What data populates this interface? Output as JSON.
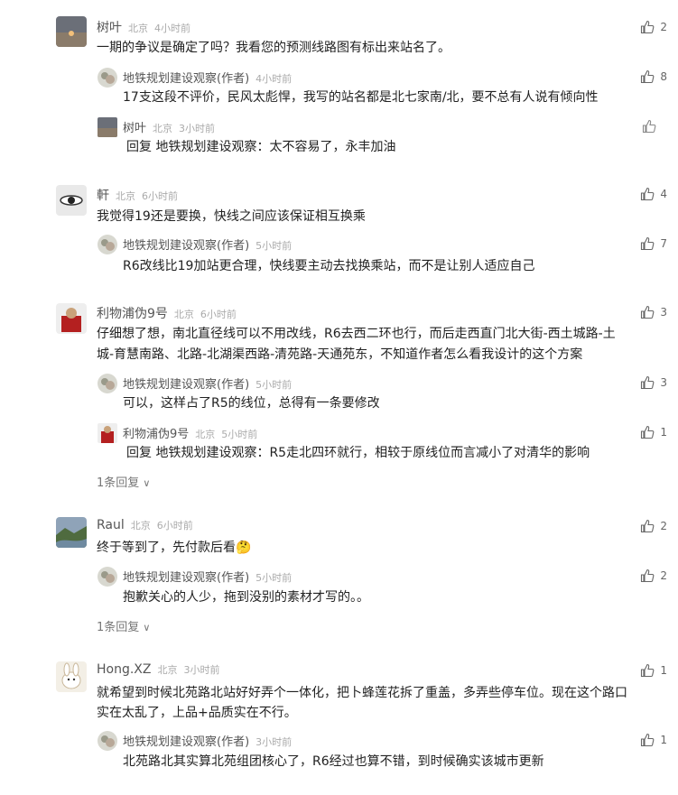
{
  "comments": [
    {
      "user": "树叶",
      "loc": "北京",
      "time": "4小时前",
      "likes": "2",
      "text": "一期的争议是确定了吗？我看您的预测线路图有标出来站名了。",
      "replies": [
        {
          "user": "地铁规划建设观察(作者)",
          "loc": "",
          "time": "4小时前",
          "likes": "8",
          "text": "17支这段不评价，民风太彪悍，我写的站名都是北七家南/北，要不总有人说有倾向性"
        },
        {
          "user": "树叶",
          "loc": "北京",
          "time": "3小时前",
          "likes": "",
          "reply_prefix": "回复",
          "reply_target": "地铁规划建设观察：",
          "text": "太不容易了，永丰加油"
        }
      ]
    },
    {
      "user": "軒",
      "loc": "北京",
      "time": "6小时前",
      "likes": "4",
      "text": "我觉得19还是要换，快线之间应该保证相互换乘",
      "replies": [
        {
          "user": "地铁规划建设观察(作者)",
          "loc": "",
          "time": "5小时前",
          "likes": "7",
          "text": "R6改线比19加站更合理，快线要主动去找换乘站，而不是让别人适应自己"
        }
      ]
    },
    {
      "user": "利物浦伪9号",
      "loc": "北京",
      "time": "6小时前",
      "likes": "3",
      "text_lines": [
        "仔细想了想，南北直径线可以不用改线，R6去西二环也行，而后走西直门北大街-西土城路-土",
        "城-育慧南路、北路-北湖渠西路-清苑路-天通苑东，不知道作者怎么看我设计的这个方案"
      ],
      "replies": [
        {
          "user": "地铁规划建设观察(作者)",
          "loc": "",
          "time": "5小时前",
          "likes": "3",
          "text": "可以，这样占了R5的线位，总得有一条要修改"
        },
        {
          "user": "利物浦伪9号",
          "loc": "北京",
          "time": "5小时前",
          "likes": "1",
          "reply_prefix": "回复",
          "reply_target": "地铁规划建设观察：",
          "text": "R5走北四环就行，相较于原线位而言减小了对清华的影响"
        }
      ],
      "more": "1条回复"
    },
    {
      "user": "Raul",
      "loc": "北京",
      "time": "6小时前",
      "likes": "2",
      "text": "终于等到了，先付款后看",
      "emoji": "🤔",
      "replies": [
        {
          "user": "地铁规划建设观察(作者)",
          "loc": "",
          "time": "5小时前",
          "likes": "2",
          "text": "抱歉关心的人少，拖到没别的素材才写的。。"
        }
      ],
      "more": "1条回复"
    },
    {
      "user": "Hong.XZ",
      "loc": "北京",
      "time": "3小时前",
      "likes": "1",
      "text_lines": [
        "就希望到时候北苑路北站好好弄个一体化，把卜蜂莲花拆了重盖，多弄些停车位。现在这个路口",
        "实在太乱了，上品+品质实在不行。"
      ],
      "replies": [
        {
          "user": "地铁规划建设观察(作者)",
          "loc": "",
          "time": "3小时前",
          "likes": "1",
          "text": "北苑路北其实算北苑组团核心了，R6经过也算不错，到时候确实该城市更新"
        }
      ]
    }
  ],
  "colors": {
    "name": "#555555",
    "meta": "#aaaaaa",
    "text": "#222222",
    "icon": "#666666"
  }
}
